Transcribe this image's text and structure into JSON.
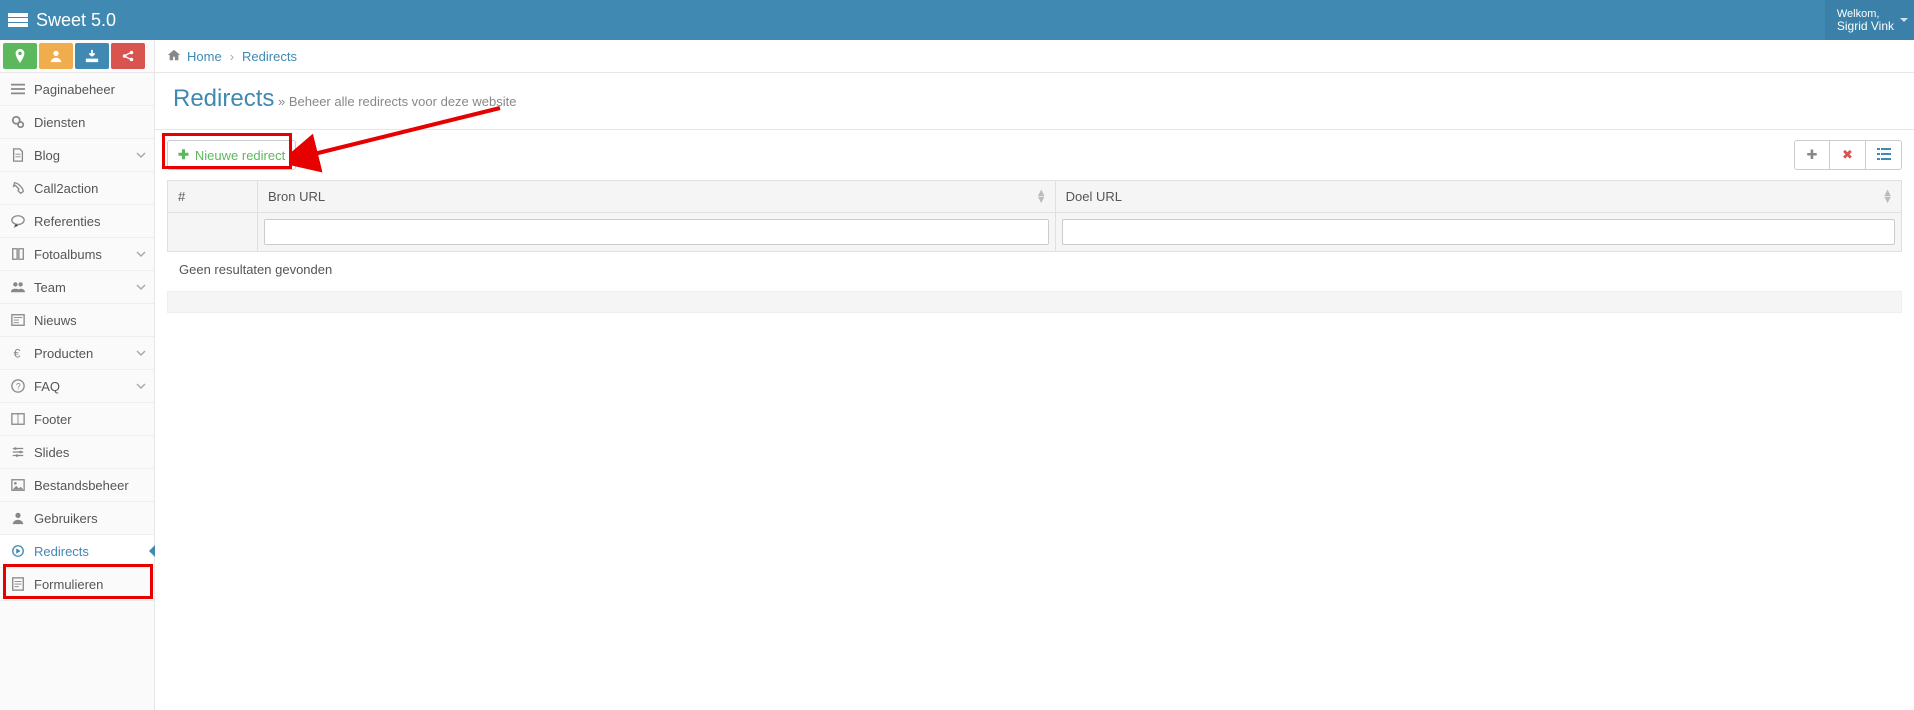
{
  "brand": "Sweet 5.0",
  "user": {
    "welcome": "Welkom,",
    "name": "Sigrid Vink"
  },
  "breadcrumb": {
    "home": "Home",
    "current": "Redirects"
  },
  "page": {
    "title": "Redirects",
    "subtitle": "Beheer alle redirects voor deze website"
  },
  "toolbar": {
    "new_label": "Nieuwe redirect"
  },
  "table": {
    "col_num": "#",
    "col_source": "Bron URL",
    "col_target": "Doel URL",
    "no_results": "Geen resultaten gevonden"
  },
  "sidebar": {
    "items": [
      {
        "label": "Paginabeheer",
        "icon": "bars",
        "expandable": false
      },
      {
        "label": "Diensten",
        "icon": "gears",
        "expandable": false
      },
      {
        "label": "Blog",
        "icon": "doc",
        "expandable": true
      },
      {
        "label": "Call2action",
        "icon": "phone",
        "expandable": false
      },
      {
        "label": "Referenties",
        "icon": "chat",
        "expandable": false
      },
      {
        "label": "Fotoalbums",
        "icon": "book",
        "expandable": true
      },
      {
        "label": "Team",
        "icon": "users",
        "expandable": true
      },
      {
        "label": "Nieuws",
        "icon": "news",
        "expandable": false
      },
      {
        "label": "Producten",
        "icon": "euro",
        "expandable": true
      },
      {
        "label": "FAQ",
        "icon": "question",
        "expandable": true
      },
      {
        "label": "Footer",
        "icon": "columns",
        "expandable": false
      },
      {
        "label": "Slides",
        "icon": "sliders",
        "expandable": false
      },
      {
        "label": "Bestandsbeheer",
        "icon": "image",
        "expandable": false
      },
      {
        "label": "Gebruikers",
        "icon": "user",
        "expandable": false
      },
      {
        "label": "Redirects",
        "icon": "redirect",
        "expandable": false,
        "active": true
      },
      {
        "label": "Formulieren",
        "icon": "form",
        "expandable": false
      }
    ]
  }
}
